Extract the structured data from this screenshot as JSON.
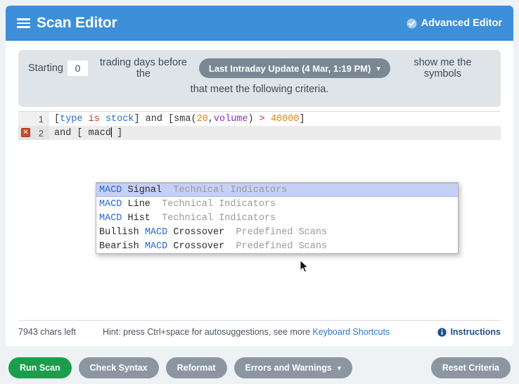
{
  "header": {
    "menu_icon": "hamburger-icon",
    "title": "Scan Editor",
    "advanced_editor_label": "Advanced Editor",
    "advanced_editor_icon": "check-circle-icon",
    "bg_color": "#3d8fd9"
  },
  "criteria": {
    "prefix": "Starting",
    "days_value": "0",
    "days_placeholder": "0",
    "middle": "trading days before the",
    "timeframe_label": "Last Intraday Update (4 Mar, 1:19 PM)",
    "timeframe_caret": "chevron-down-icon",
    "suffix": "show me the symbols",
    "line2": "that meet the following criteria."
  },
  "editor": {
    "lines": [
      {
        "number": "1",
        "has_error": false,
        "error_icon": "",
        "active": false,
        "tokens": [
          {
            "text": "[",
            "color": "dark"
          },
          {
            "text": "type",
            "color": "blue"
          },
          {
            "text": " ",
            "color": "dark"
          },
          {
            "text": "is",
            "color": "red"
          },
          {
            "text": " ",
            "color": "dark"
          },
          {
            "text": "stock",
            "color": "blue"
          },
          {
            "text": "] ",
            "color": "dark"
          },
          {
            "text": "and",
            "color": "dark"
          },
          {
            "text": " [",
            "color": "dark"
          },
          {
            "text": "sma",
            "color": "dark"
          },
          {
            "text": "(",
            "color": "dark"
          },
          {
            "text": "20",
            "color": "orange"
          },
          {
            "text": ",",
            "color": "dark"
          },
          {
            "text": "volume",
            "color": "purple"
          },
          {
            "text": ") ",
            "color": "dark"
          },
          {
            "text": ">",
            "color": "red"
          },
          {
            "text": " ",
            "color": "dark"
          },
          {
            "text": "40000",
            "color": "orange"
          },
          {
            "text": "]",
            "color": "dark"
          }
        ]
      },
      {
        "number": "2",
        "has_error": true,
        "error_icon": "error-x-icon",
        "active": true,
        "tokens": [
          {
            "text": "and [ macd",
            "color": "dark"
          },
          {
            "text": "|caret|",
            "color": "dark"
          },
          {
            "text": " ]",
            "color": "dark"
          }
        ]
      }
    ]
  },
  "autocomplete": {
    "items": [
      {
        "name_pre": "",
        "name_match": "MACD",
        "name_post": " Signal",
        "category": "Technical Indicators",
        "selected": true
      },
      {
        "name_pre": "",
        "name_match": "MACD",
        "name_post": " Line",
        "category": "Technical Indicators",
        "selected": false
      },
      {
        "name_pre": "",
        "name_match": "MACD",
        "name_post": " Hist",
        "category": "Technical Indicators",
        "selected": false
      },
      {
        "name_pre": "Bullish ",
        "name_match": "MACD",
        "name_post": " Crossover",
        "category": "Predefined Scans",
        "selected": false
      },
      {
        "name_pre": "Bearish ",
        "name_match": "MACD",
        "name_post": " Crossover",
        "category": "Predefined Scans",
        "selected": false
      }
    ]
  },
  "statusbar": {
    "chars_left": "7943 chars left",
    "hint_text": "Hint: press Ctrl+space for autosuggestions, see more ",
    "hint_link": "Keyboard Shortcuts",
    "instructions_label": "Instructions",
    "instructions_icon": "info-icon"
  },
  "footer": {
    "run_scan": "Run Scan",
    "check_syntax": "Check Syntax",
    "reformat": "Reformat",
    "errors_warnings": "Errors and Warnings",
    "errors_warnings_caret": "chevron-down-icon",
    "reset_criteria": "Reset Criteria",
    "run_scan_color": "#1b9e4b",
    "gray_button_color": "#8b96a1"
  }
}
